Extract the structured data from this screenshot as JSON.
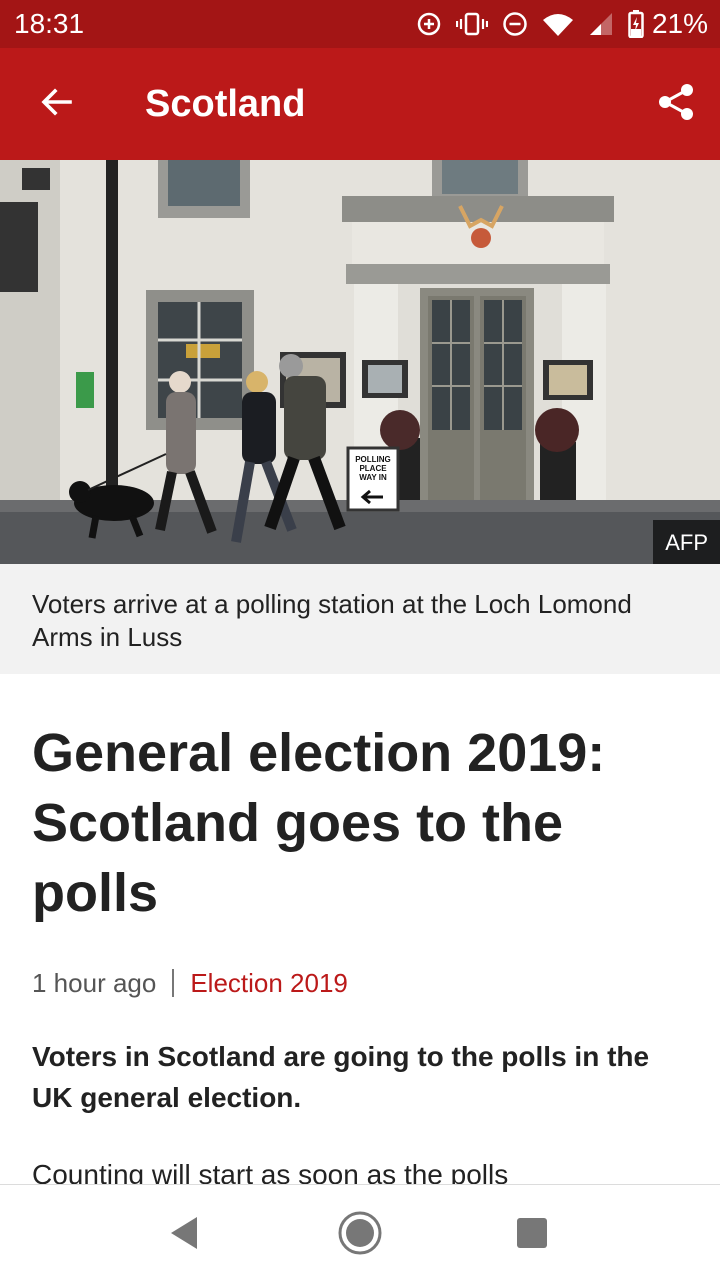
{
  "status_bar": {
    "time": "18:31",
    "battery_percent": "21%",
    "icons": [
      "data-saver-icon",
      "vibrate-icon",
      "do-not-disturb-icon",
      "wifi-icon",
      "signal-icon",
      "battery-charging-icon"
    ]
  },
  "app_bar": {
    "title": "Scotland",
    "back_icon": "arrow-back-icon",
    "share_icon": "share-icon",
    "background": "#bb1919"
  },
  "hero": {
    "credit": "AFP",
    "sign_text": [
      "POLLING",
      "PLACE",
      "WAY IN"
    ],
    "caption": "Voters arrive at a polling station at the Loch Lomond Arms in Luss"
  },
  "article": {
    "headline": "General election 2019: Scotland goes to the polls",
    "time_ago": "1 hour ago",
    "topic": "Election 2019",
    "summary": "Voters in Scotland are going to the polls in the UK general election.",
    "body_start": "Counting will start as soon as the polls"
  },
  "nav_bar": {
    "back_icon": "nav-back-triangle-icon",
    "home_icon": "nav-home-circle-icon",
    "recents_icon": "nav-recents-square-icon"
  },
  "colors": {
    "brand_red": "#bb1919",
    "status_red": "#a31515",
    "caption_bg": "#f2f2f2",
    "text": "#222222"
  }
}
